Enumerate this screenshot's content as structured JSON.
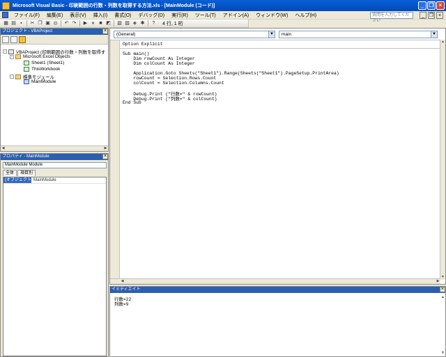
{
  "titlebar": {
    "title": "Microsoft Visual Basic - 印刷範囲の行数・列数を取得する方法.xls - [MainModule (コード)]",
    "minimize": "_",
    "restore": "❐",
    "close": "×"
  },
  "menubar": {
    "items": [
      "ファイル(F)",
      "編集(E)",
      "表示(V)",
      "挿入(I)",
      "書式(O)",
      "デバッグ(D)",
      "実行(R)",
      "ツール(T)",
      "アドイン(A)",
      "ウィンドウ(W)",
      "ヘルプ(H)"
    ],
    "help_placeholder": "質問を入力してください",
    "mdi_min": "_",
    "mdi_restore": "❐",
    "mdi_close": "×"
  },
  "toolbar": {
    "cursor_position": "4 行, 1 桁"
  },
  "project_explorer": {
    "title": "プロジェクト - VBAProject",
    "close": "×",
    "tree": {
      "project": "VBAProject (印刷範囲の行数・列数を取得す",
      "folder_objects": "Microsoft Excel Objects",
      "sheet1": "Sheet1 (Sheet1)",
      "thisworkbook": "ThisWorkbook",
      "folder_modules": "標準モジュール",
      "module": "MainModule"
    },
    "expanders": [
      "-",
      "-",
      "-"
    ]
  },
  "properties": {
    "title": "プロパティ - MainModule",
    "close": "×",
    "object_select": "MainModule Module",
    "tabs": [
      "全体",
      "項目別"
    ],
    "rows": [
      {
        "name": "(オブジェクト名)",
        "value": "MainModule"
      }
    ]
  },
  "code_window": {
    "object_combo": "(General)",
    "procedure_combo": "main",
    "lines": [
      "Option Explicit",
      "Sub main()",
      "    Dim rowCount As Integer",
      "    Dim colCount As Integer",
      "",
      "    Application.Goto Sheets(\"Sheet1\").Range(Sheets(\"Sheet1\").PageSetup.PrintArea)",
      "    rowCount = Selection.Rows.Count",
      "    colCount = Selection.Columns.Count",
      "",
      "    Debug.Print (\"行数=\" & rowCount)",
      "    Debug.Print (\"列数=\" & colCount)",
      "End Sub"
    ]
  },
  "immediate": {
    "title": "イミディエイト",
    "close": "×",
    "lines": [
      "行数=22",
      "列数=9"
    ]
  },
  "scroll": {
    "up": "▲",
    "down": "▼",
    "left": "◀",
    "right": "▶"
  }
}
